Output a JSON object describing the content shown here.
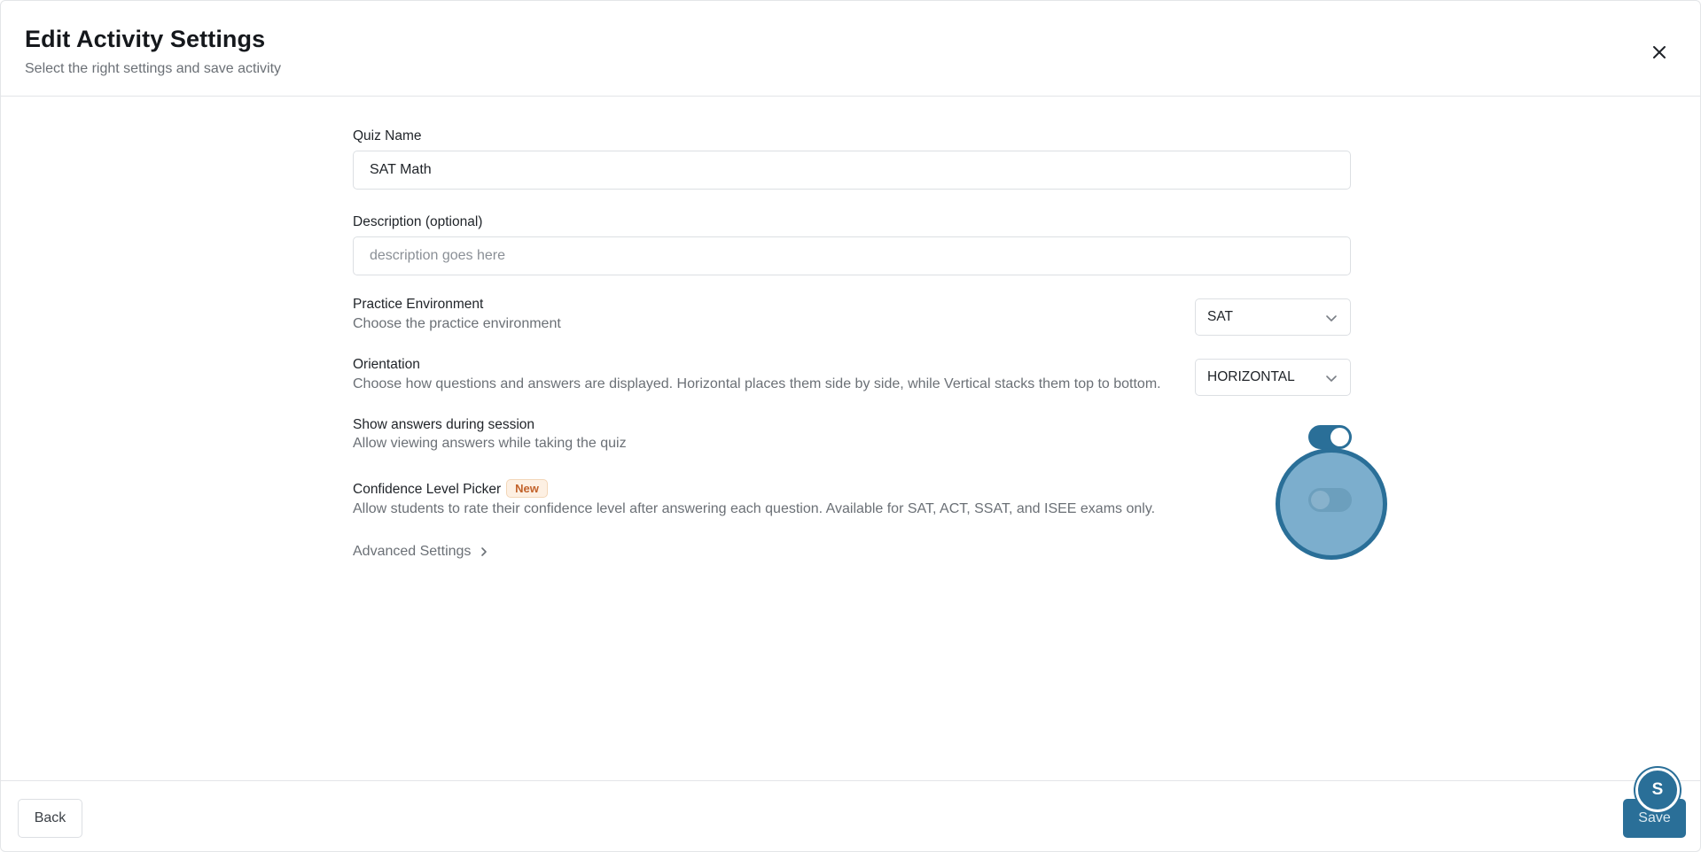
{
  "header": {
    "title": "Edit Activity Settings",
    "subtitle": "Select the right settings and save activity"
  },
  "form": {
    "quiz_name": {
      "label": "Quiz Name",
      "value": "SAT Math"
    },
    "description": {
      "label": "Description (optional)",
      "value": "",
      "placeholder": "description goes here"
    },
    "practice_environment": {
      "title": "Practice Environment",
      "description": "Choose the practice environment",
      "selected": "SAT"
    },
    "orientation": {
      "title": "Orientation",
      "description": "Choose how questions and answers are displayed. Horizontal places them side by side, while Vertical stacks them top to bottom.",
      "selected": "HORIZONTAL"
    },
    "show_answers": {
      "title": "Show answers during session",
      "description": "Allow viewing answers while taking the quiz",
      "enabled": true
    },
    "confidence_picker": {
      "title": "Confidence Level Picker",
      "badge": "New",
      "description": "Allow students to rate their confidence level after answering each question. Available for SAT, ACT, SSAT, and ISEE exams only.",
      "enabled": false
    },
    "advanced_settings": {
      "label": "Advanced Settings"
    }
  },
  "footer": {
    "back_label": "Back",
    "save_label": "Save"
  },
  "help_fab": {
    "label": "S"
  },
  "colors": {
    "accent": "#2a6f98",
    "badge_text": "#c2622a",
    "badge_bg": "#fdf0e3"
  },
  "icons": {
    "close": "close-icon",
    "chevron_down": "chevron-down-icon",
    "chevron_right": "chevron-right-icon"
  }
}
